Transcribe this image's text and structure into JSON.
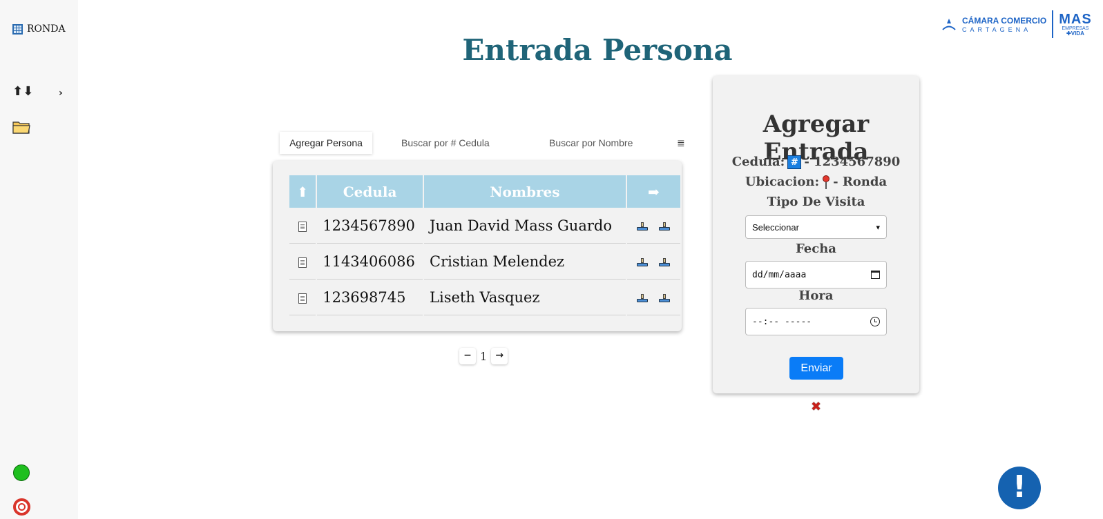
{
  "sidebar": {
    "brand_label": "RONDA",
    "chevron": "›",
    "items": [
      {
        "icon": "sort-arrows-icon"
      },
      {
        "icon": "folder-icon"
      }
    ],
    "status": [
      {
        "icon": "green-circle-icon",
        "color": "#1fbf1f"
      },
      {
        "icon": "stop-circle-icon",
        "color": "#d9352b"
      }
    ]
  },
  "logo": {
    "line1": "CÁMARA COMERCIO",
    "line2": "CARTAGENA",
    "mas": "MAS",
    "mas_sub1": "EMPRESAS",
    "mas_sub2": "✚VIDA"
  },
  "page_title": "Entrada Persona",
  "tabs": {
    "add": "Agregar Persona",
    "by_id": "Buscar por # Cedula",
    "by_name": "Buscar por Nombre",
    "list_icon": "≣"
  },
  "table": {
    "headers": {
      "sort": "⬆",
      "cedula": "Cedula",
      "nombres": "Nombres",
      "action": "➡"
    },
    "rows": [
      {
        "cedula": "1234567890",
        "nombres": "Juan David Mass Guardo"
      },
      {
        "cedula": "1143406086",
        "nombres": "Cristian Melendez"
      },
      {
        "cedula": "123698745",
        "nombres": "Liseth Vasquez"
      }
    ]
  },
  "pager": {
    "prev": "−",
    "page": "1",
    "next": "→"
  },
  "form": {
    "title": "Agregar Entrada",
    "cedula_label": "Cedula:",
    "cedula_hash": "#",
    "cedula_value": "- 1234567890",
    "ubicacion_label": "Ubicacion:",
    "ubicacion_value": "- Ronda",
    "tipo_label": "Tipo De Visita",
    "tipo_selected": "Seleccionar",
    "fecha_label": "Fecha",
    "fecha_placeholder": "dd/mm/aaaa",
    "hora_label": "Hora",
    "hora_placeholder": "--:-- -----",
    "submit": "Enviar"
  },
  "close_symbol": "✖",
  "help_symbol": "!",
  "colors": {
    "title": "#1f6478",
    "table_header": "#a9d4e6",
    "primary": "#0a7cf7",
    "help": "#1562b0"
  }
}
